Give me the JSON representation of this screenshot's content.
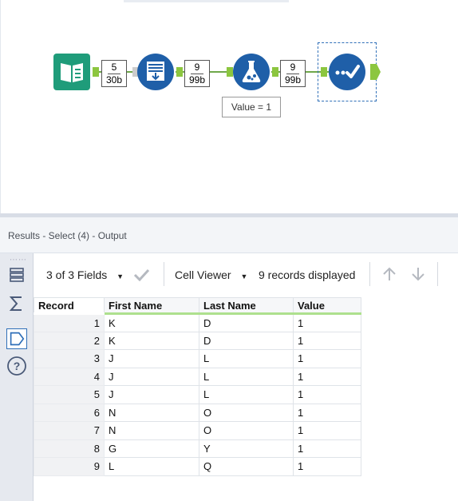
{
  "canvas": {
    "badges": [
      {
        "records": "5",
        "size": "30b"
      },
      {
        "records": "9",
        "size": "99b"
      },
      {
        "records": "9",
        "size": "99b"
      }
    ],
    "annotation": "Value = 1",
    "tools": [
      {
        "icon": "input-data-book-icon",
        "color": "#1f9c7a"
      },
      {
        "icon": "text-input-icon",
        "color": "#1f5fa8"
      },
      {
        "icon": "formula-flask-icon",
        "color": "#1f5fa8"
      },
      {
        "icon": "select-checkmark-icon",
        "color": "#1f5fa8"
      }
    ],
    "connector_color": "#6fa84a",
    "port_color": "#8cc63f"
  },
  "results": {
    "title": "Results - Select (4) - Output",
    "toolbar": {
      "fields": "3 of 3 Fields",
      "viewer": "Cell Viewer",
      "records": "9 records displayed"
    },
    "columns": [
      "Record",
      "First Name",
      "Last Name",
      "Value"
    ],
    "rows": [
      [
        "1",
        "K",
        "D",
        "1"
      ],
      [
        "2",
        "K",
        "D",
        "1"
      ],
      [
        "3",
        "J",
        "L",
        "1"
      ],
      [
        "4",
        "J",
        "L",
        "1"
      ],
      [
        "5",
        "J",
        "L",
        "1"
      ],
      [
        "6",
        "N",
        "O",
        "1"
      ],
      [
        "7",
        "N",
        "O",
        "1"
      ],
      [
        "8",
        "G",
        "Y",
        "1"
      ],
      [
        "9",
        "L",
        "Q",
        "1"
      ]
    ]
  }
}
